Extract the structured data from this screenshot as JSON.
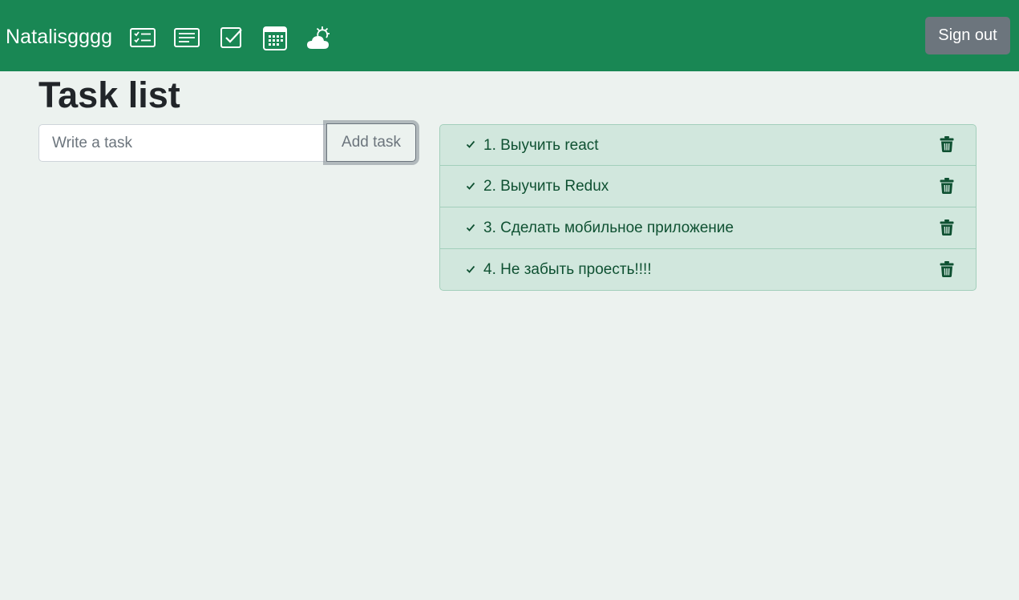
{
  "navbar": {
    "brand": "Natalisgggg",
    "icons": [
      "checklist-card-icon",
      "text-card-icon",
      "check-square-icon",
      "calendar-icon",
      "weather-cloud-sun-icon"
    ],
    "signout_label": "Sign out",
    "background": "#198754"
  },
  "page": {
    "title": "Task list"
  },
  "form": {
    "placeholder": "Write a task",
    "value": "",
    "add_label": "Add task"
  },
  "tasks": [
    {
      "label": "1. Выучить react"
    },
    {
      "label": "2. Выучить Redux"
    },
    {
      "label": "3. Сделать мобильное приложение"
    },
    {
      "label": "4. Не забыть проесть!!!!"
    }
  ],
  "colors": {
    "accent": "#198754",
    "task_bg": "#d1e7dd",
    "task_text": "#0f5132",
    "page_bg": "#ecf2ef",
    "secondary": "#6c757d"
  }
}
